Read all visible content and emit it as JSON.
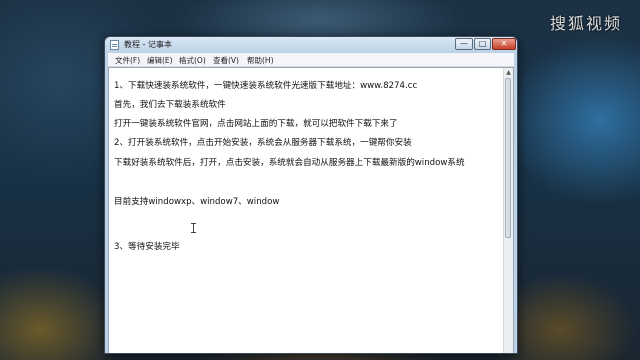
{
  "watermark": "搜狐视频",
  "window": {
    "title": "教程 - 记事本",
    "controls": {
      "minimize": "—",
      "maximize": "□",
      "close": "✕"
    }
  },
  "menu": [
    "文件(F)",
    "编辑(E)",
    "格式(O)",
    "查看(V)",
    "帮助(H)"
  ],
  "document": {
    "lines": [
      "1、下载快速装系统软件，一键快速装系统软件光速版下载地址：www.8274.cc",
      "首先，我们去下载装系统软件",
      "打开一键装系统软件官网，点击网站上面的下载，就可以把软件下载下来了",
      "2、打开装系统软件，点击开始安装，系统会从服务器下载系统，一键帮你安装",
      "下载好装系统软件后，打开，点击安装，系统就会自动从服务器上下载最新版的window系统",
      "目前支持windowxp、window7、window",
      "3、等待安装完毕"
    ]
  },
  "icons": {
    "app": "notepad-icon",
    "caret": "text-cursor-icon"
  }
}
